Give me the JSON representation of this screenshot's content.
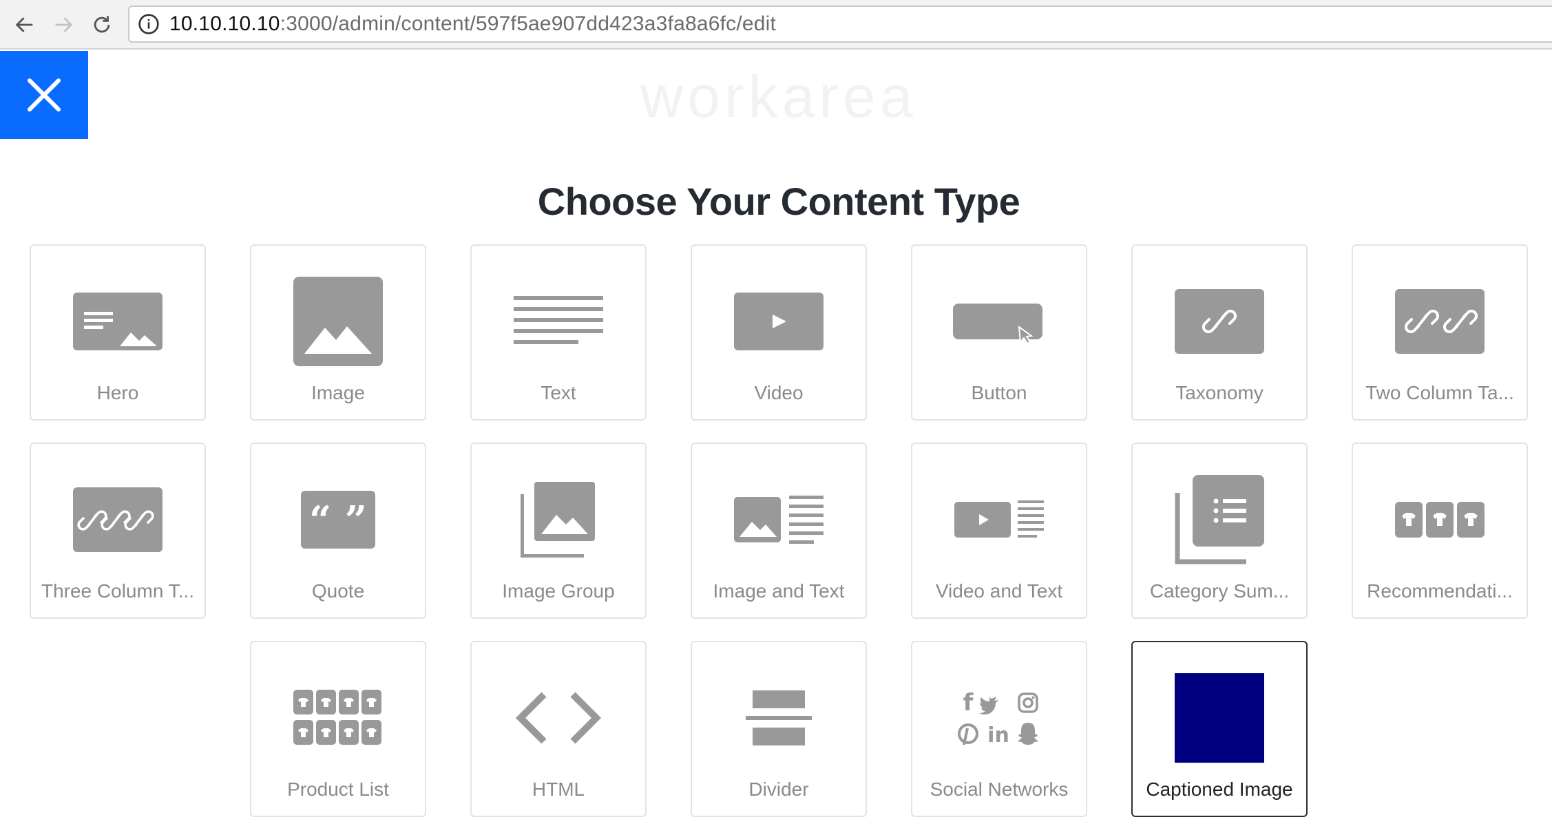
{
  "browser": {
    "url_host": "10.10.10.10",
    "url_path": ":3000/admin/content/597f5ae907dd423a3fa8a6fc/edit"
  },
  "page": {
    "brand": "workarea",
    "title": "Choose Your Content Type"
  },
  "colors": {
    "accent": "#0a6cff",
    "icon_gray": "#999999",
    "selected_preview": "#000080"
  },
  "content_types": [
    {
      "label": "Hero",
      "icon": "hero-icon"
    },
    {
      "label": "Image",
      "icon": "image-icon"
    },
    {
      "label": "Text",
      "icon": "text-icon"
    },
    {
      "label": "Video",
      "icon": "video-icon"
    },
    {
      "label": "Button",
      "icon": "button-icon"
    },
    {
      "label": "Taxonomy",
      "icon": "taxonomy-icon"
    },
    {
      "label": "Two Column Ta...",
      "icon": "two-column-taxonomy-icon"
    },
    {
      "label": "Three Column T...",
      "icon": "three-column-taxonomy-icon"
    },
    {
      "label": "Quote",
      "icon": "quote-icon"
    },
    {
      "label": "Image Group",
      "icon": "image-group-icon"
    },
    {
      "label": "Image and Text",
      "icon": "image-and-text-icon"
    },
    {
      "label": "Video and Text",
      "icon": "video-and-text-icon"
    },
    {
      "label": "Category Sum...",
      "icon": "category-summary-icon"
    },
    {
      "label": "Recommendati...",
      "icon": "recommendations-icon"
    },
    {
      "label": "Product List",
      "icon": "product-list-icon"
    },
    {
      "label": "HTML",
      "icon": "html-icon"
    },
    {
      "label": "Divider",
      "icon": "divider-icon"
    },
    {
      "label": "Social Networks",
      "icon": "social-networks-icon"
    },
    {
      "label": "Captioned Image",
      "icon": "captioned-image-icon",
      "selected": true
    }
  ]
}
